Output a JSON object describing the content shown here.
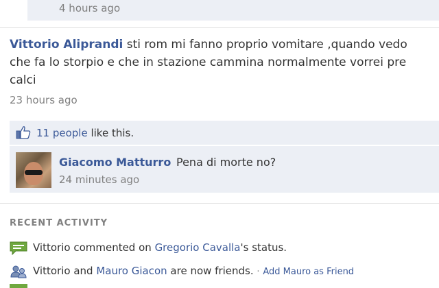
{
  "previous_post": {
    "timestamp": "4 hours ago"
  },
  "post": {
    "author": "Vittorio Aliprandi",
    "lines": [
      "sti rom mi fanno proprio vomitare ,quando vedo",
      "che fa lo storpio e che in stazione cammina normalmente vorrei pre",
      "calci"
    ],
    "timestamp": "23 hours ago"
  },
  "likes": {
    "count_link": "11 people",
    "suffix": " like this."
  },
  "comment": {
    "author": "Giacomo Matturro",
    "text": "Pena di morte no?",
    "timestamp": "24 minutes ago"
  },
  "recent_activity": {
    "header": "RECENT ACTIVITY",
    "items": [
      {
        "icon": "comment-icon",
        "parts": [
          "Vittorio commented on ",
          "Gregorio Cavalla",
          "'s status."
        ]
      },
      {
        "icon": "friends-icon",
        "parts": [
          "Vittorio and ",
          "Mauro Giacon",
          " are now friends."
        ],
        "action": "Add Mauro as Friend"
      }
    ]
  },
  "colors": {
    "link": "#3b5998",
    "muted": "#808080",
    "panel": "#eceff5"
  }
}
